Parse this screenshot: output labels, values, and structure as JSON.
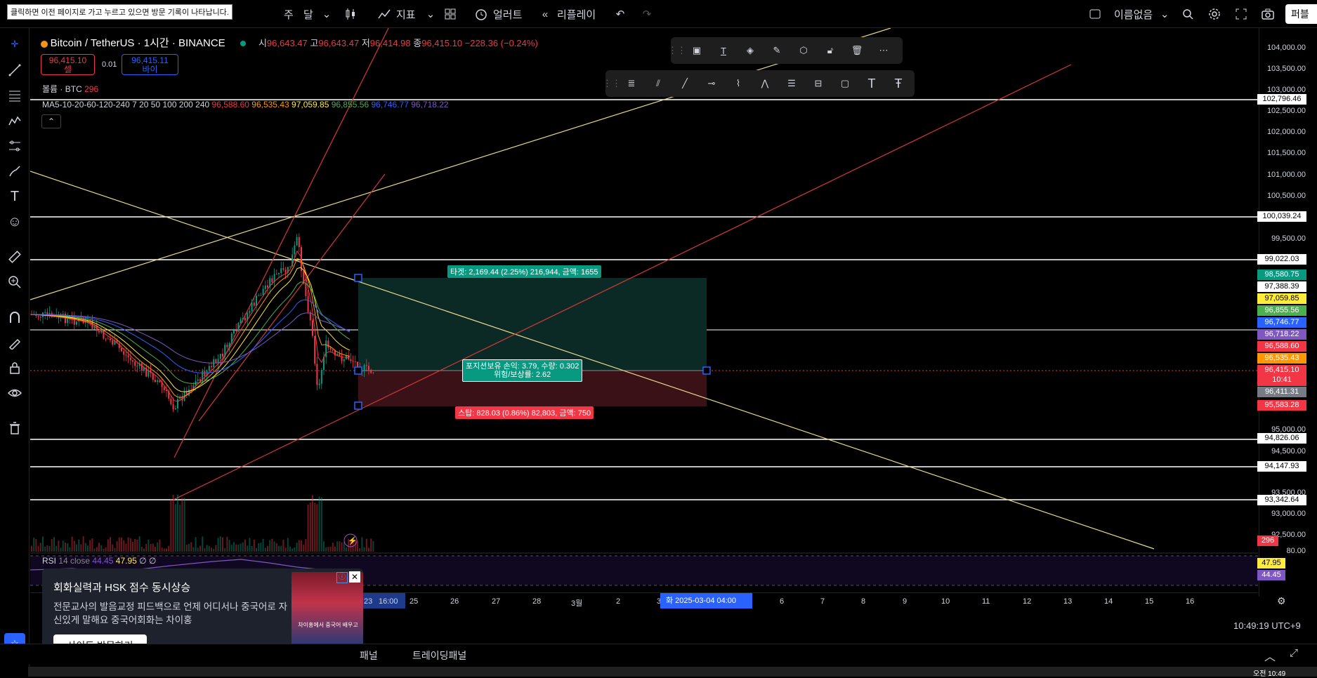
{
  "tooltip": "클릭하면 이전 페이지로 가고 누르고 있으면 방문 기록이 나타납니다.",
  "toolbar": {
    "timeframe_week": "주",
    "timeframe_month": "달",
    "indicators": "지표",
    "alert": "얼러트",
    "replay": "리플레이",
    "layout_name": "이름없음",
    "publish": "퍼블리"
  },
  "symbol": {
    "title": "Bitcoin / TetherUS · 1시간 · BINANCE",
    "open_label": "시",
    "open": "96,643.47",
    "high_label": "고",
    "high": "96,643.47",
    "low_label": "저",
    "low": "96,414.98",
    "close_label": "종",
    "close": "96,415.10",
    "change": "−228.36 (−0.24%)"
  },
  "trade": {
    "sell_price": "96,415.10",
    "sell_label": "셀",
    "qty": "0.01",
    "buy_price": "96,415.11",
    "buy_label": "바이"
  },
  "volume": {
    "label": "볼륨 · BTC",
    "value": "296"
  },
  "ma": {
    "label": "MA5-10-20-60-120-240",
    "periods": "7 20 50 100 200 240",
    "v1": "96,588.60",
    "v2": "96,535.43",
    "v3": "97,059.85",
    "v4": "96,855.56",
    "v5": "96,746.77",
    "v6": "96,718.22"
  },
  "rsi": {
    "label": "RSI",
    "params": "14 close",
    "v1": "44.45",
    "v2": "47.95",
    "v3": "∅ ∅"
  },
  "price_axis": [
    "104,000.00",
    "103,500.00",
    "103,000.00",
    "102,500.00",
    "102,000.00",
    "101,500.00",
    "101,000.00",
    "100,500.00",
    "99,500.00",
    "95,000.00",
    "94,500.00",
    "93,500.00",
    "93,000.00",
    "92,500.00",
    "80.00"
  ],
  "price_tags": {
    "h1": "102,796.46",
    "h2": "100,039.24",
    "h3": "99,022.03",
    "t1": "98,580.75",
    "t2": "97,388.39",
    "t3": "97,059.85",
    "t4": "96,855.56",
    "t5": "96,746.77",
    "t6": "96,718.22",
    "t7": "96,588.60",
    "t8": "96,535.43",
    "t9": "96,415.10",
    "t9b": "10:41",
    "t10": "96,411.31",
    "t11": "95,583.28",
    "h4": "94,826.06",
    "h5": "94,147.93",
    "h6": "93,342.64",
    "vol": "296",
    "rsi1": "47.95",
    "rsi2": "44.45"
  },
  "position": {
    "target": "타겟: 2,169.44 (2.25%) 216,944, 금액: 1655",
    "open_line1": "포지션보유 손익: 3.79, 수량: 0.302",
    "open_line2": "위험/보상률: 2.62",
    "stop": "스탑: 828.03 (0.86%) 82,803, 금액: 750"
  },
  "time_axis": {
    "d1": "23",
    "d1t": "16:00",
    "d2": "25",
    "d3": "26",
    "d4": "27",
    "d5": "28",
    "d6": "3월",
    "d7": "2",
    "d8": "3",
    "cursor": "화 2025-03-04   04:00",
    "d9": "6",
    "d10": "7",
    "d11": "8",
    "d12": "9",
    "d13": "10",
    "d14": "11",
    "d15": "12",
    "d16": "13",
    "d17": "14",
    "d18": "15",
    "d19": "16"
  },
  "clock": "10:49:19 UTC+9",
  "ad": {
    "title": "회화실력과 HSK 점수 동시상승",
    "body": "전문교사의 발음교정 피드백으로 언제 어디서나 중국어로 자신있게 말해요 중국어회화는 차이홍",
    "button": "사이트 방문하기",
    "tag": "광고",
    "image_caption": "차이홍에서 중국어 배우고"
  },
  "bottom_tabs": {
    "panel": "패널",
    "trading": "트레이딩패널"
  },
  "taskbar": {
    "time": "오전 10:49"
  },
  "colors": {
    "up": "#089981",
    "down": "#f23645",
    "accent": "#2962ff"
  }
}
